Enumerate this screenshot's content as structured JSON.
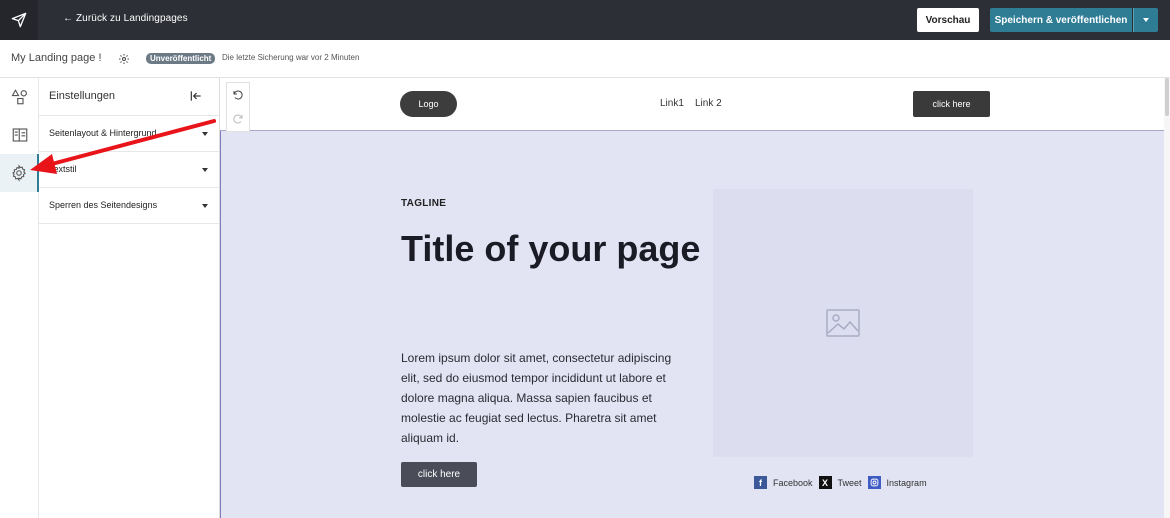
{
  "topbar": {
    "back_label": "← Zurück zu Landingpages",
    "preview_label": "Vorschau",
    "save_label": "Speichern & veröffentlichen",
    "accent": "#2f7d95"
  },
  "subbar": {
    "page_name": "My Landing page !",
    "status": "Unveröffentlicht",
    "save_info": "Die letzte Sicherung war vor 2 Minuten"
  },
  "rail": {
    "items": [
      {
        "icon": "elements-icon"
      },
      {
        "icon": "layout-icon"
      },
      {
        "icon": "settings-gear-icon",
        "active": true
      }
    ]
  },
  "panel": {
    "title": "Einstellungen",
    "items": [
      {
        "label": "Seitenlayout & Hintergrund"
      },
      {
        "label": "Textstil"
      },
      {
        "label": "Sperren des Seitendesigns"
      }
    ]
  },
  "canvas": {
    "nav": {
      "logo": "Logo",
      "links": [
        "Link1",
        "Link 2"
      ],
      "cta": "click here"
    },
    "hero": {
      "tagline": "TAGLINE",
      "title": "Title of your page",
      "body": "Lorem ipsum dolor sit amet, consectetur adipiscing elit, sed do eiusmod tempor incididunt ut labore et dolore magna aliqua. Massa sapien faucibus et molestie ac feugiat sed lectus. Pharetra sit amet aliquam id.",
      "button": "click here",
      "background": "#e2e3f3"
    },
    "socials": [
      {
        "label": "Facebook",
        "icon": "facebook-icon",
        "color": "#3b5998"
      },
      {
        "label": "Tweet",
        "icon": "x-icon",
        "color": "#111111"
      },
      {
        "label": "Instagram",
        "icon": "instagram-icon",
        "color": "#3f5bc4"
      }
    ]
  }
}
